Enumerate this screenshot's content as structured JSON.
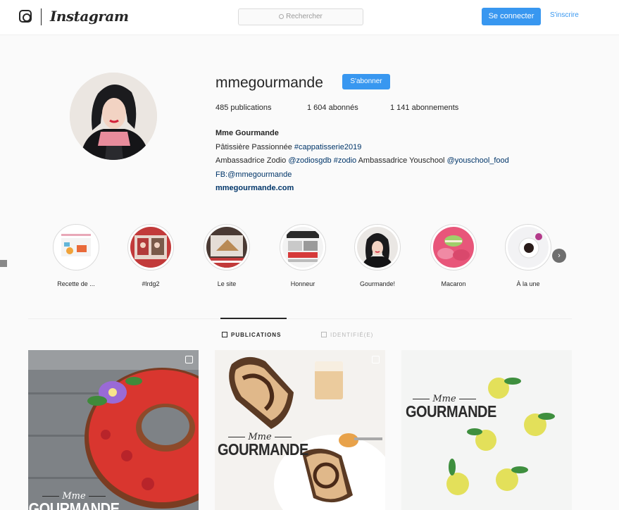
{
  "nav": {
    "brand": "Instagram",
    "search_placeholder": "Rechercher",
    "login_label": "Se connecter",
    "signup_label": "S'inscrire"
  },
  "profile": {
    "username": "mmegourmande",
    "follow_label": "S'abonner",
    "stats": {
      "posts": "485 publications",
      "followers": "1 604 abonnés",
      "following": "1 141 abonnements"
    },
    "bio": {
      "full_name": "Mme Gourmande",
      "line1_text": "Pâtissière Passionnée ",
      "line1_tag": "#cappatisserie2019",
      "line2_a": "Ambassadrice Zodio ",
      "line2_tag1": "@zodiosgdb",
      "line2_tag2": "#zodio",
      "line2_b": " Ambassadrice Youschool ",
      "line2_tag3": "@youschool_food",
      "line3_a": "FB:",
      "line3_tag": "@mmegourmande",
      "website": "mmegourmande.com"
    }
  },
  "highlights": [
    {
      "label": "Recette de ..."
    },
    {
      "label": "#lrdg2"
    },
    {
      "label": "Le site"
    },
    {
      "label": "Honneur"
    },
    {
      "label": "Gourmande!"
    },
    {
      "label": "Macaron"
    },
    {
      "label": "À la une"
    }
  ],
  "tabs": {
    "publications": "PUBLICATIONS",
    "tagged": "IDENTIFIÉ(E)"
  },
  "watermark": {
    "mme": "Mme",
    "gourmande": "GOURMANDE"
  },
  "colors": {
    "accent": "#3897f0",
    "link": "#003569",
    "text": "#262626",
    "background": "#fafafa"
  },
  "icons": [
    "instagram-logo-icon",
    "search-icon",
    "chevron-right-icon",
    "grid-icon",
    "tagged-icon",
    "multiple-photos-icon"
  ]
}
